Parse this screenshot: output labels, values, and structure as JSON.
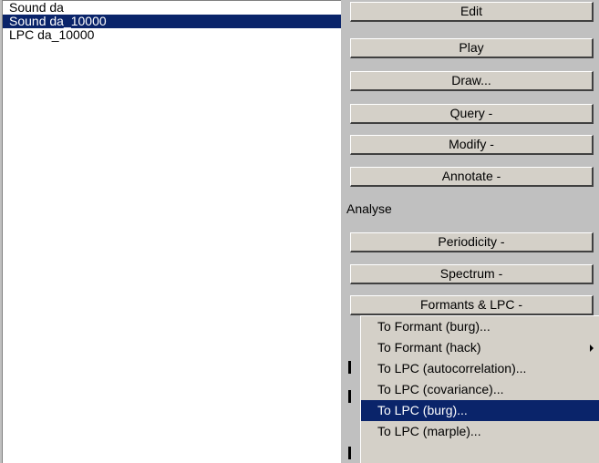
{
  "objects": [
    {
      "label": "Sound da",
      "selected": false
    },
    {
      "label": "Sound da_10000",
      "selected": true
    },
    {
      "label": "LPC da_10000",
      "selected": false
    }
  ],
  "buttons": {
    "edit": "Edit",
    "play": "Play",
    "draw": "Draw...",
    "query": "Query -",
    "modify": "Modify -",
    "annotate": "Annotate -",
    "periodicity": "Periodicity -",
    "spectrum": "Spectrum -",
    "formants": "Formants & LPC -"
  },
  "section": {
    "analyse": "Analyse"
  },
  "menu": {
    "items": [
      {
        "label": "To Formant (burg)...",
        "submenu": false,
        "highlighted": false
      },
      {
        "label": "To Formant (hack)",
        "submenu": true,
        "highlighted": false
      },
      {
        "label": "To LPC (autocorrelation)...",
        "submenu": false,
        "highlighted": false
      },
      {
        "label": "To LPC (covariance)...",
        "submenu": false,
        "highlighted": false
      },
      {
        "label": "To LPC (burg)...",
        "submenu": false,
        "highlighted": true
      },
      {
        "label": "To LPC (marple)...",
        "submenu": false,
        "highlighted": false
      }
    ]
  },
  "colors": {
    "selection": "#0a246a",
    "panel": "#c0c0c0",
    "button": "#d4d0c8"
  }
}
